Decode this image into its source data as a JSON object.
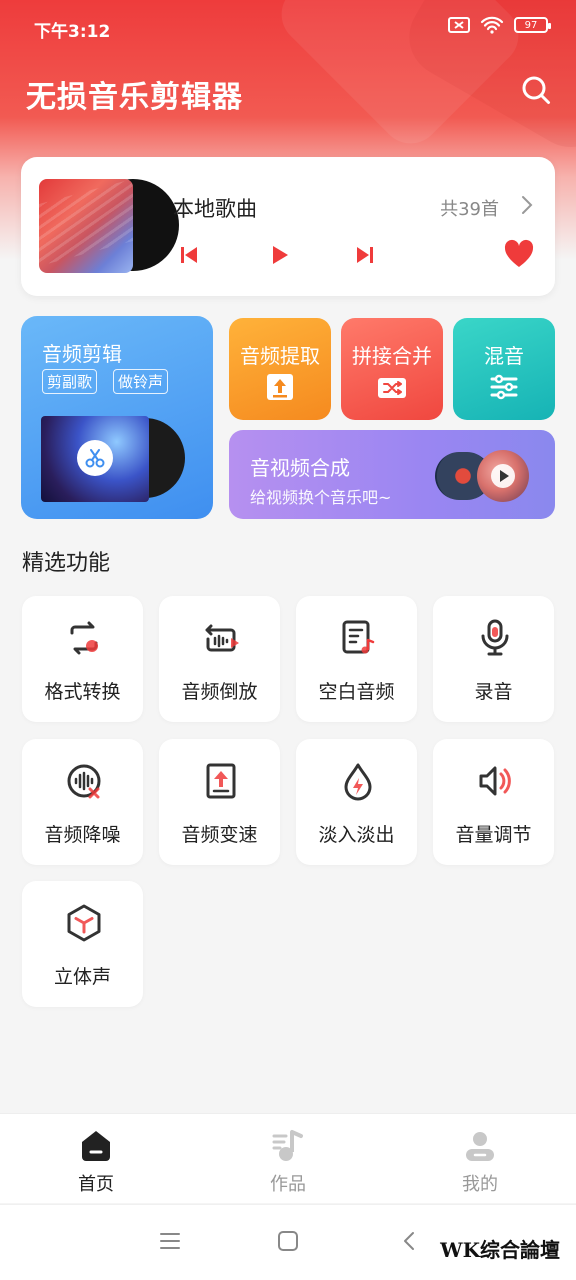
{
  "status_bar": {
    "time": "下午3:12",
    "battery": "97"
  },
  "header": {
    "title": "无损音乐剪辑器",
    "search_icon": "search-icon"
  },
  "player": {
    "title": "本地歌曲",
    "count": "共39首",
    "controls": [
      "prev-icon",
      "play-icon",
      "next-icon"
    ],
    "favorite_icon": "heart-icon"
  },
  "tools": {
    "audio_edit": {
      "title": "音频剪辑",
      "tags": [
        "剪副歌",
        "做铃声"
      ]
    },
    "extract": {
      "title": "音频提取"
    },
    "concat": {
      "title": "拼接合并"
    },
    "mix": {
      "title": "混音"
    },
    "av_merge": {
      "title": "音视频合成",
      "subtitle": "给视频换个音乐吧~"
    }
  },
  "features": {
    "title": "精选功能",
    "items": [
      {
        "label": "格式转换",
        "icon": "format-convert-icon"
      },
      {
        "label": "音频倒放",
        "icon": "reverse-icon"
      },
      {
        "label": "空白音频",
        "icon": "blank-audio-icon"
      },
      {
        "label": "录音",
        "icon": "microphone-icon"
      },
      {
        "label": "音频降噪",
        "icon": "denoise-icon"
      },
      {
        "label": "音频变速",
        "icon": "speed-icon"
      },
      {
        "label": "淡入淡出",
        "icon": "fade-icon"
      },
      {
        "label": "音量调节",
        "icon": "volume-icon"
      },
      {
        "label": "立体声",
        "icon": "stereo-icon"
      }
    ]
  },
  "bottom_nav": [
    {
      "label": "首页",
      "icon": "home-icon",
      "active": true
    },
    {
      "label": "作品",
      "icon": "music-note-icon",
      "active": false
    },
    {
      "label": "我的",
      "icon": "user-icon",
      "active": false
    }
  ],
  "colors": {
    "accent": "#ef3b3b",
    "active_nav": "#222222",
    "inactive_nav": "#9a9a9a"
  },
  "watermark": "WK综合論壇"
}
